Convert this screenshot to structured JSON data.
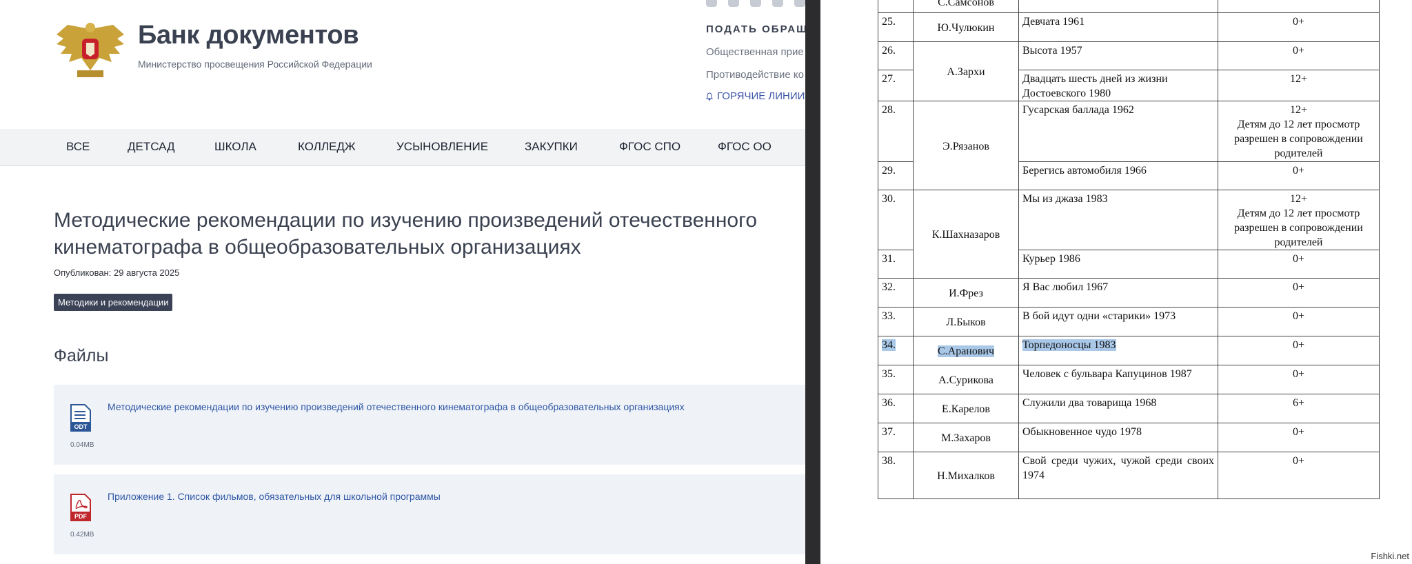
{
  "site": {
    "title": "Банк документов",
    "subtitle": "Министерство просвещения Российской Федерации",
    "social_icons": [
      "vk-icon",
      "odnoklassniki-icon",
      "rutube-icon",
      "telegram-icon",
      "dzen-icon"
    ],
    "right_links": {
      "heading": "ПОДАТЬ ОБРАЩ",
      "items": [
        "Общественная прие",
        "Противодействие ко"
      ],
      "hotline": "ГОРЯЧИЕ ЛИНИИ"
    },
    "nav": [
      "ВСЕ",
      "ДЕТСАД",
      "ШКОЛА",
      "КОЛЛЕДЖ",
      "УСЫНОВЛЕНИЕ",
      "ЗАКУПКИ",
      "ФГОС СПО",
      "ФГОС ОО"
    ],
    "page_title_lines": [
      "Методические рекомендации по изучению произведений отечественного",
      "кинематографа в общеобразовательных организациях"
    ],
    "published": "Опубликован: 29 августа 2025",
    "tag": "Методики и рекомендации",
    "files_heading": "Файлы",
    "files": [
      {
        "type": "ODT",
        "size": "0.04MB",
        "name": "Методические рекомендации по изучению произведений отечественного кинематографа в общеобразовательных организациях",
        "color": "#2b5797"
      },
      {
        "type": "PDF",
        "size": "0.42MB",
        "name": "Приложение 1. Список фильмов, обязательных для школьной программы",
        "color": "#c0272d"
      }
    ]
  },
  "doc": {
    "prev_director_fragment": "С.Самсонов",
    "rows": [
      {
        "num": "25.",
        "director": "Ю.Чулюкин",
        "title": "Девчата 1961",
        "age": "0+"
      },
      {
        "num": "26.",
        "director": "А.Зархи",
        "title": "Высота 1957",
        "age": "0+"
      },
      {
        "num": "27.",
        "title": "Двадцать шесть дней из жизни Достоевского 1980",
        "age": "12+"
      },
      {
        "num": "28.",
        "director": "Э.Рязанов",
        "title": "Гусарская баллада 1962",
        "age": "12+",
        "note": "Детям до 12 лет просмотр разрешен в сопровождении родителей"
      },
      {
        "num": "29.",
        "title": "Берегись автомобиля 1966",
        "age": "0+"
      },
      {
        "num": "30.",
        "director": "К.Шахназаров",
        "title": "Мы из джаза 1983",
        "age": "12+",
        "note": "Детям до 12 лет просмотр разрешен в сопровождении родителей"
      },
      {
        "num": "31.",
        "title": "Курьер 1986",
        "age": "0+"
      },
      {
        "num": "32.",
        "director": "И.Фрез",
        "title": "Я Вас любил 1967",
        "age": "0+"
      },
      {
        "num": "33.",
        "director": "Л.Быков",
        "title": "В бой идут одни «старики» 1973",
        "age": "0+"
      },
      {
        "num": "34.",
        "director": "С.Аранович",
        "title": "Торпедоносцы 1983",
        "age": "0+",
        "highlighted": true
      },
      {
        "num": "35.",
        "director": "А.Сурикова",
        "title": "Человек с бульвара Капуцинов 1987",
        "age": "0+"
      },
      {
        "num": "36.",
        "director": "Е.Карелов",
        "title": "Служили два товарища 1968",
        "age": "6+"
      },
      {
        "num": "37.",
        "director": "М.Захаров",
        "title": "Обыкновенное чудо 1978",
        "age": "0+"
      },
      {
        "num": "38.",
        "director": "Н.Михалков",
        "title": "Свой среди чужих, чужой среди своих 1974",
        "age": "0+"
      }
    ],
    "watermark": "Fishki.net",
    "highlight_color": "#a9c8e8"
  }
}
